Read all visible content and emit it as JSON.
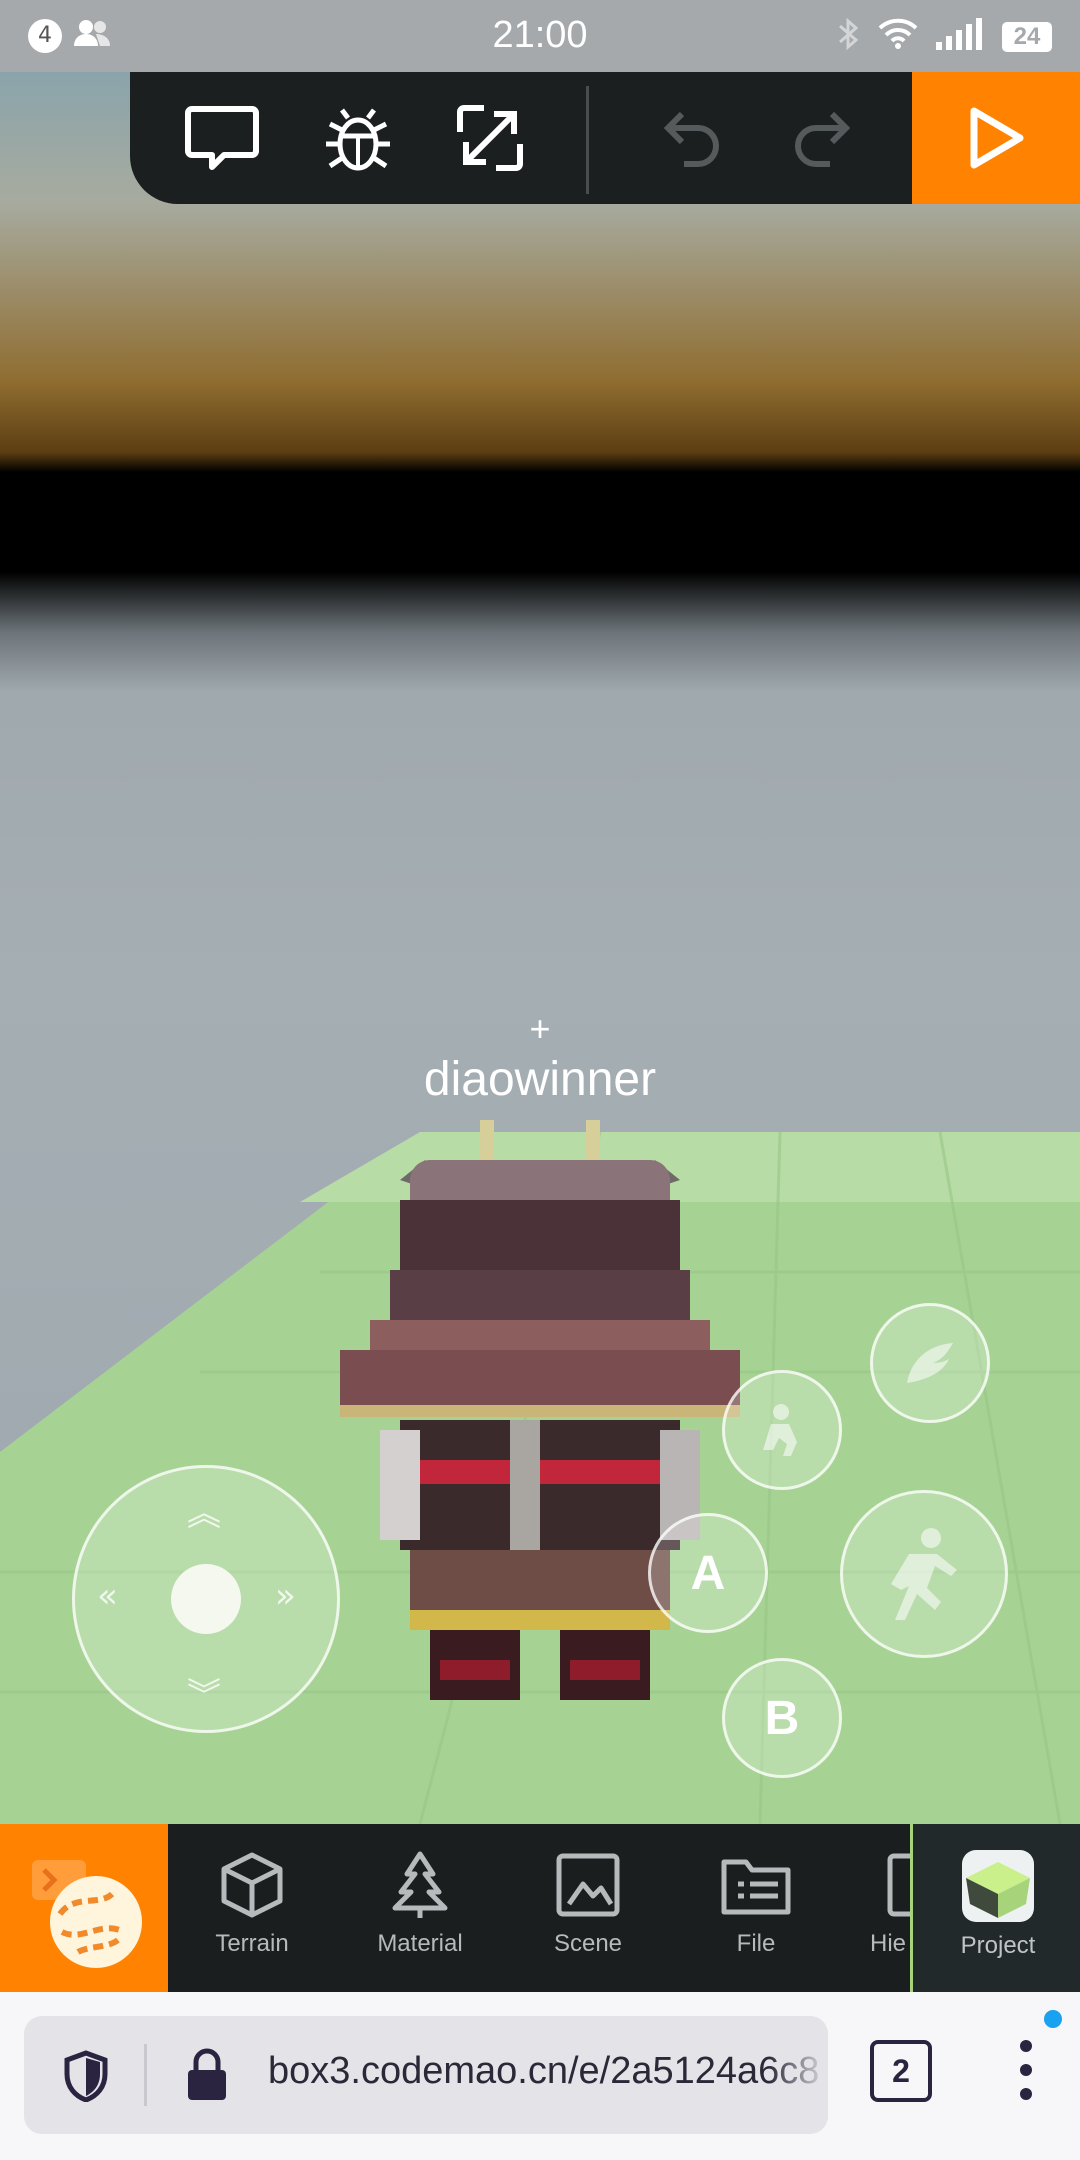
{
  "status_bar": {
    "time": "21:00",
    "notification_count": "4",
    "battery": "24"
  },
  "toolbar": {
    "icons": [
      "chat-icon",
      "bug-icon",
      "fullscreen-icon",
      "undo-icon",
      "redo-icon",
      "play-icon"
    ],
    "accent_color": "#ff8200"
  },
  "game": {
    "crosshair": "+",
    "player_name": "diaowinner"
  },
  "controls": {
    "button_a": "A",
    "button_b": "B"
  },
  "editor_tabs": {
    "items": [
      {
        "label": "Terrain"
      },
      {
        "label": "Material"
      },
      {
        "label": "Scene"
      },
      {
        "label": "File"
      },
      {
        "label": "Hie"
      }
    ],
    "project_label": "Project"
  },
  "browser": {
    "url": "box3.codemao.cn/e/2a5124a6c8",
    "tab_count": "2"
  }
}
